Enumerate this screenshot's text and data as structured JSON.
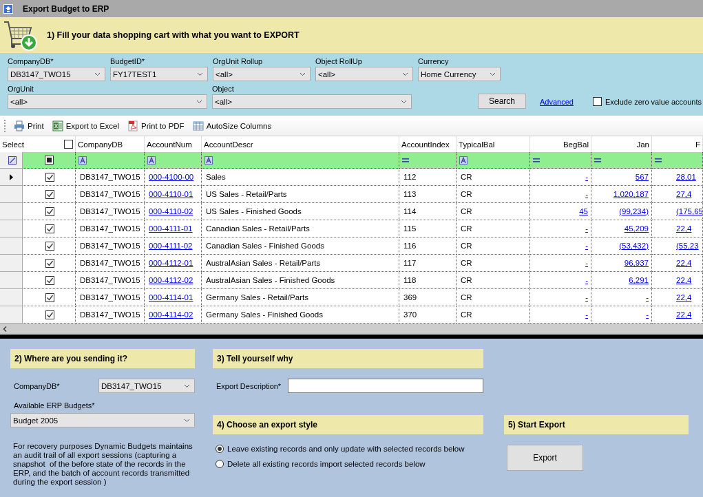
{
  "window": {
    "title": "Export Budget to ERP"
  },
  "step1": {
    "heading": "1) Fill your data shopping cart with what you want to EXPORT"
  },
  "filters_top": [
    {
      "label": "CompanyDB*",
      "value": "DB3147_TWO15"
    },
    {
      "label": "BudgetID*",
      "value": "FY17TEST1"
    },
    {
      "label": "OrgUnit Rollup",
      "value": "<all>"
    },
    {
      "label": "Object RollUp",
      "value": "<all>"
    },
    {
      "label": "Currency",
      "value": "Home Currency"
    }
  ],
  "filters_bottom": [
    {
      "label": "OrgUnit",
      "value": "<all>"
    },
    {
      "label": "Object",
      "value": "<all>"
    }
  ],
  "search_button": "Search",
  "advanced_link": "Advanced",
  "exclude_zero": {
    "label": "Exclude zero value accounts",
    "checked": false
  },
  "toolbar": [
    {
      "kind": "print",
      "label": "Print"
    },
    {
      "kind": "excel",
      "label": "Export to Excel"
    },
    {
      "kind": "pdf",
      "label": "Print to PDF"
    },
    {
      "kind": "autosize",
      "label": "AutoSize Columns"
    }
  ],
  "grid": {
    "select_header": "Select",
    "select_all_checked": false,
    "filter_checked": true,
    "columns": [
      {
        "label": "CompanyDB",
        "kind": "text"
      },
      {
        "label": "AccountNum",
        "kind": "link"
      },
      {
        "label": "AccountDescr",
        "kind": "text"
      },
      {
        "label": "AccountIndex",
        "kind": "number"
      },
      {
        "label": "TypicalBal",
        "kind": "text"
      },
      {
        "label": "BegBal",
        "kind": "amount"
      },
      {
        "label": "Jan",
        "kind": "amount"
      },
      {
        "label": "F",
        "kind": "amount"
      }
    ],
    "rows": [
      {
        "selected": true,
        "checked": true,
        "cells": [
          "DB3147_TWO15",
          "000-4100-00",
          "Sales",
          "112",
          "CR",
          "-",
          "567",
          "28,01"
        ]
      },
      {
        "selected": false,
        "checked": true,
        "cells": [
          "DB3147_TWO15",
          "000-4110-01",
          "US Sales - Retail/Parts",
          "113",
          "CR",
          "-",
          "1,020,187",
          "27,4"
        ]
      },
      {
        "selected": false,
        "checked": true,
        "cells": [
          "DB3147_TWO15",
          "000-4110-02",
          "US Sales - Finished Goods",
          "114",
          "CR",
          "45",
          "(99,234)",
          "(175,65"
        ]
      },
      {
        "selected": false,
        "checked": true,
        "cells": [
          "DB3147_TWO15",
          "000-4111-01",
          "Canadian Sales - Retail/Parts",
          "115",
          "CR",
          "-",
          "45,209",
          "22,4"
        ]
      },
      {
        "selected": false,
        "checked": true,
        "cells": [
          "DB3147_TWO15",
          "000-4111-02",
          "Canadian Sales - Finished Goods",
          "116",
          "CR",
          "-",
          "(53,432)",
          "(55,23"
        ]
      },
      {
        "selected": false,
        "checked": true,
        "cells": [
          "DB3147_TWO15",
          "000-4112-01",
          "AustralAsian Sales - Retail/Parts",
          "117",
          "CR",
          "-",
          "96,937",
          "22,4"
        ]
      },
      {
        "selected": false,
        "checked": true,
        "cells": [
          "DB3147_TWO15",
          "000-4112-02",
          "AustralAsian Sales - Finished Goods",
          "118",
          "CR",
          "-",
          "6,291",
          "22,4"
        ]
      },
      {
        "selected": false,
        "checked": true,
        "cells": [
          "DB3147_TWO15",
          "000-4114-01",
          "Germany Sales - Retail/Parts",
          "369",
          "CR",
          "-",
          "-",
          "22,4"
        ]
      },
      {
        "selected": false,
        "checked": true,
        "cells": [
          "DB3147_TWO15",
          "000-4114-02",
          "Germany Sales - Finished Goods",
          "370",
          "CR",
          "-",
          "-",
          "22,4"
        ]
      }
    ]
  },
  "step2": {
    "heading": "2) Where are you sending it?",
    "company_label": "CompanyDB*",
    "company_value": "DB3147_TWO15",
    "budgets_label": "Available ERP Budgets*",
    "budgets_value": "Budget 2005",
    "note": "For recovery purposes Dynamic Budgets maintains an audit trail of all export sessions (capturing a snapshot  of the before state of the records in the ERP, and the batch of account records transmitted during the export session )"
  },
  "step3": {
    "heading": "3) Tell yourself why",
    "description_label": "Export Description*"
  },
  "step4": {
    "heading": "4) Choose an export style",
    "options": [
      {
        "label": "Leave existing records and only update with selected records below",
        "selected": true
      },
      {
        "label": "Delete all existing records  import selected records below",
        "selected": false
      }
    ]
  },
  "step5": {
    "heading": "5) Start Export",
    "button": "Export"
  }
}
